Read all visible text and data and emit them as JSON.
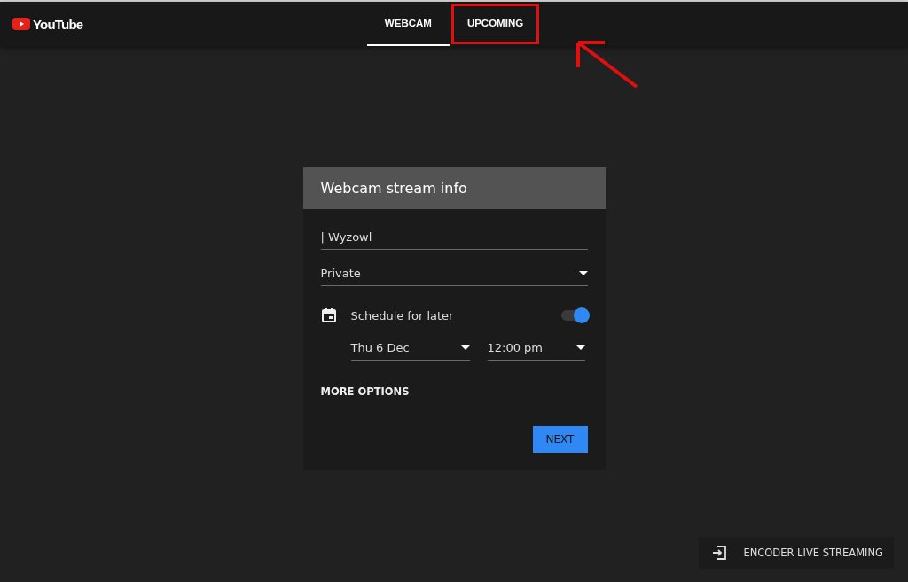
{
  "logo": {
    "text": "YouTube"
  },
  "tabs": [
    {
      "label": "WEBCAM",
      "selected": true
    },
    {
      "label": "UPCOMING",
      "selected": false,
      "highlighted": true
    }
  ],
  "dialog": {
    "title": "Webcam stream info",
    "title_field": {
      "value": "| Wyzowl"
    },
    "privacy": {
      "value": "Private"
    },
    "schedule": {
      "label": "Schedule for later",
      "on": true
    },
    "date": {
      "value": "Thu 6 Dec"
    },
    "time": {
      "value": "12:00 pm"
    },
    "more_options": "MORE OPTIONS",
    "next_button": "NEXT"
  },
  "encoder_button": {
    "label": "ENCODER LIVE STREAMING"
  }
}
